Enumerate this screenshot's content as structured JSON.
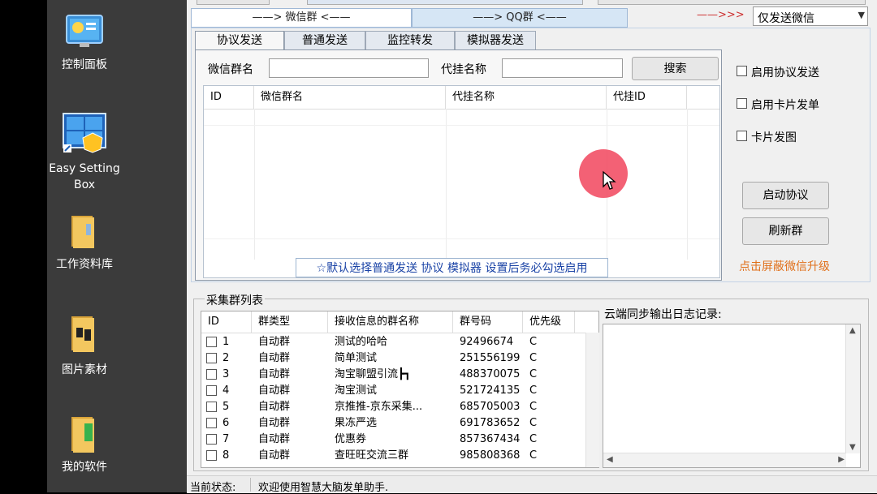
{
  "desktop": {
    "icons": [
      {
        "label": "控制面板",
        "icon": "control-panel-icon"
      },
      {
        "label": "Easy Setting Box",
        "icon": "easy-setting-box-icon"
      },
      {
        "label": "工作资料库",
        "icon": "folder-icon"
      },
      {
        "label": "图片素材",
        "icon": "folder-icon"
      },
      {
        "label": "我的软件",
        "icon": "folder-icon"
      }
    ]
  },
  "app": {
    "channels": {
      "wechat": "——> 微信群 <——",
      "qq": "——> QQ群 <——"
    },
    "mode": {
      "arrow": "——>>>",
      "selected": "仅发送微信"
    },
    "tabs": [
      "协议发送",
      "普通发送",
      "监控转发",
      "模拟器发送"
    ],
    "search": {
      "group_label": "微信群名",
      "group_value": "",
      "agent_label": "代挂名称",
      "agent_value": "",
      "search_button": "搜索"
    },
    "grid": {
      "columns": [
        "ID",
        "微信群名",
        "代挂名称",
        "代挂ID"
      ],
      "hint": "☆默认选择普通发送 协议 模拟器 设置后务必勾选启用"
    },
    "options": [
      {
        "label": "启用协议发送",
        "checked": false
      },
      {
        "label": "启用卡片发单",
        "checked": false
      },
      {
        "label": "卡片发图",
        "checked": false
      }
    ],
    "buttons": {
      "start": "启动协议",
      "refresh": "刷新群"
    },
    "upgrade_link": "点击屏蔽微信升级",
    "collect": {
      "title": "采集群列表",
      "columns": [
        "ID",
        "群类型",
        "接收信息的群名称",
        "群号码",
        "优先级"
      ],
      "rows": [
        {
          "id": "1",
          "type": "自动群",
          "name": "测试的哈哈",
          "number": "92496674",
          "priority": "C"
        },
        {
          "id": "2",
          "type": "自动群",
          "name": "简单测试",
          "number": "251556199",
          "priority": "C"
        },
        {
          "id": "3",
          "type": "自动群",
          "name": "淘宝聊盟引流┣┓",
          "number": "488370075",
          "priority": "C"
        },
        {
          "id": "4",
          "type": "自动群",
          "name": "淘宝测试",
          "number": "521724135",
          "priority": "C"
        },
        {
          "id": "5",
          "type": "自动群",
          "name": "京推推-京东采集...",
          "number": "685705003",
          "priority": "C"
        },
        {
          "id": "6",
          "type": "自动群",
          "name": "果冻严选",
          "number": "691783652",
          "priority": "C"
        },
        {
          "id": "7",
          "type": "自动群",
          "name": "优惠券",
          "number": "857367434",
          "priority": "C"
        },
        {
          "id": "8",
          "type": "自动群",
          "name": "查旺旺交流三群",
          "number": "985808368",
          "priority": "C"
        }
      ]
    },
    "log": {
      "title": "云端同步输出日志记录:"
    },
    "status": {
      "label": "当前状态:",
      "text": "欢迎使用智慧大脑发单助手."
    },
    "colors": {
      "accent_red": "#cc2e2e",
      "link_orange": "#e0701b",
      "hint_blue": "#1a43a6",
      "cursor_dot": "#f25066"
    }
  }
}
